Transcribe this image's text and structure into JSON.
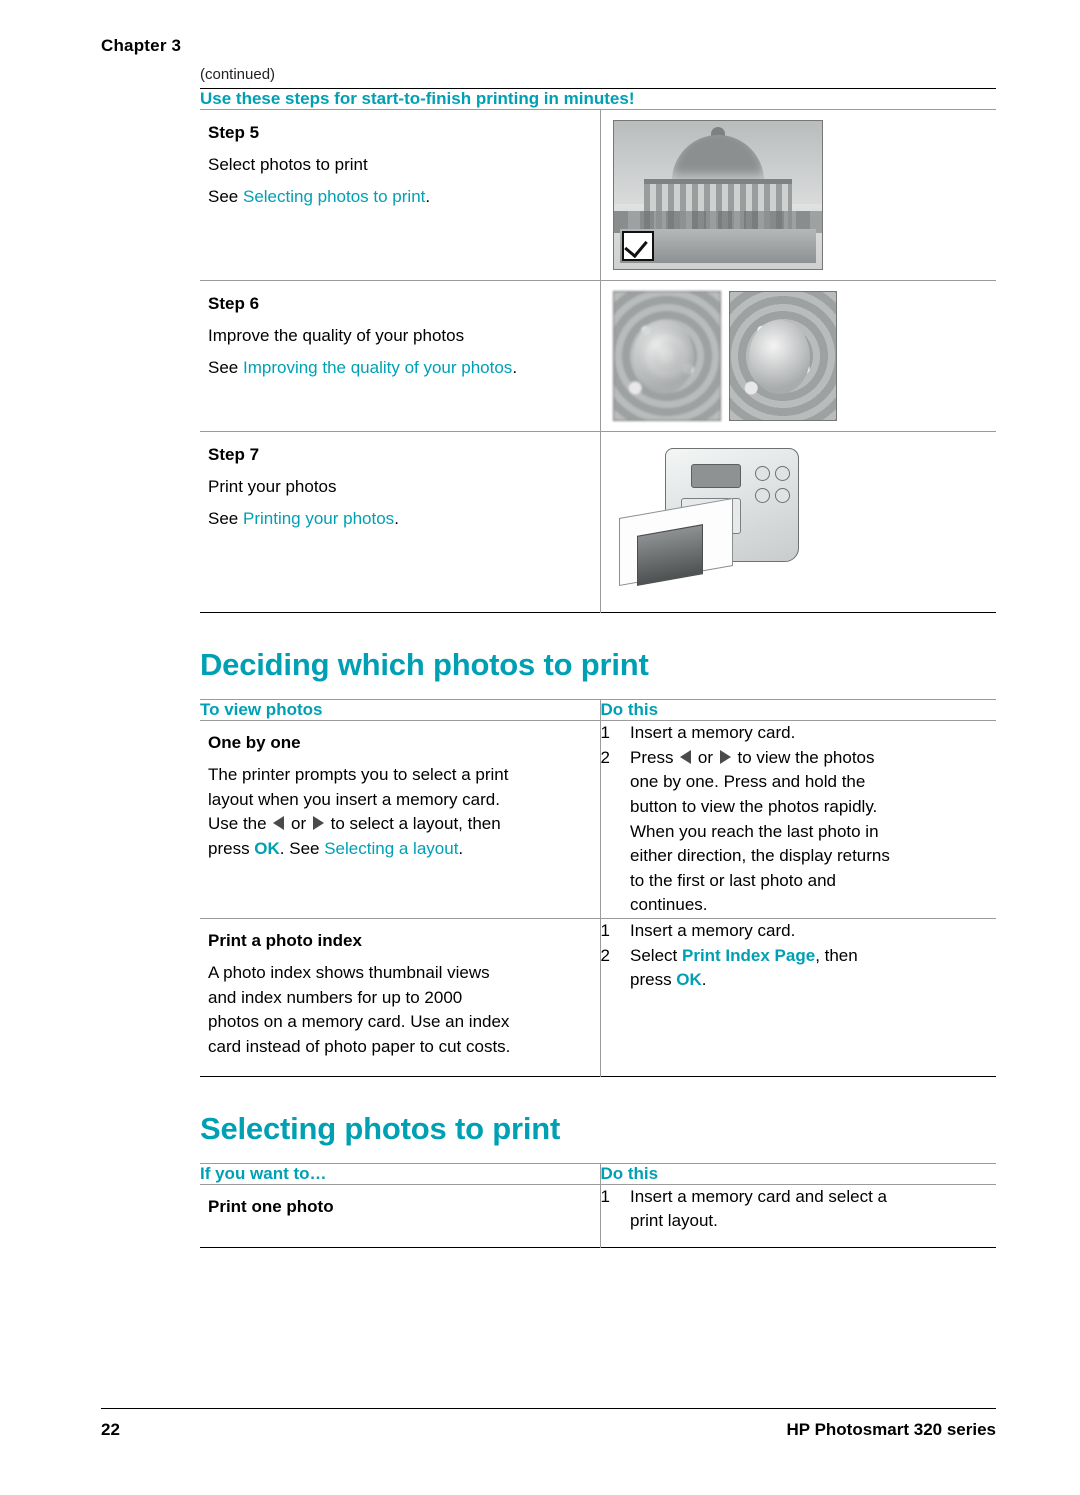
{
  "header": {
    "chapter": "Chapter 3",
    "continued": "(continued)"
  },
  "steps_table": {
    "title": "Use these steps for start-to-finish printing in minutes!",
    "rows": [
      {
        "step_label": "Step",
        "step_number": "5",
        "text": "Select photos to print",
        "see_prefix": "See ",
        "see_link": "Selecting photos to print",
        "see_suffix": ".",
        "image": "photo-of-monument-with-checkbox"
      },
      {
        "step_label": "Step",
        "step_number": "6",
        "text": "Improve the quality of your photos",
        "see_prefix": "See ",
        "see_link": "Improving the quality of your photos",
        "see_suffix": ".",
        "image": "two-flower-photos-blurred-and-sharp"
      },
      {
        "step_label": "Step",
        "step_number": "7",
        "text": "Print your photos",
        "see_prefix": "See ",
        "see_link": "Printing your photos",
        "see_suffix": ".",
        "image": "printer-printing-photo"
      }
    ]
  },
  "section_deciding": {
    "heading": "Deciding which photos to print",
    "col1_header": "To view photos",
    "col2_header": "Do this",
    "rows": [
      {
        "subhead": "One by one",
        "body_lines": [
          "The printer prompts you to select a print",
          "layout when you insert a memory card.",
          "Use the ◀ or ▶ to select a layout, then",
          "press OK. See Selecting a layout."
        ],
        "numbers": [
          "1",
          "2"
        ],
        "do_lines": [
          "Insert a memory card.",
          "Press ◀ or ▶ to view the photos",
          "one by one. Press and hold the",
          "button to view the photos rapidly.",
          "When you reach the last photo in",
          "either direction, the display returns",
          "to the first or last photo and",
          "continues."
        ]
      },
      {
        "subhead": "Print a photo index",
        "body_lines": [
          "A photo index shows thumbnail views",
          "and index numbers for up to 2000",
          "photos on a memory card. Use an index",
          "card instead of photo paper to cut costs."
        ],
        "numbers": [
          "1",
          "2"
        ],
        "do_lines": [
          "Insert a memory card.",
          "Select Print Index Page, then",
          "press OK."
        ]
      }
    ]
  },
  "section_selecting": {
    "heading": "Selecting photos to print",
    "col1_header": "If you want to…",
    "col2_header": "Do this",
    "rows": [
      {
        "subhead": "Print one photo",
        "numbers": [
          "1"
        ],
        "do_lines": [
          "Insert a memory card and select a",
          "print layout."
        ]
      }
    ]
  },
  "inline_terms": {
    "ok": "OK",
    "selecting_a_layout": "Selecting a layout",
    "print_index_page": "Print Index Page"
  },
  "footer": {
    "page_number": "22",
    "product": "HP Photosmart 320 series"
  },
  "colors": {
    "accent": "#00a0b4",
    "rule": "#9b9b9b",
    "text": "#000000"
  }
}
